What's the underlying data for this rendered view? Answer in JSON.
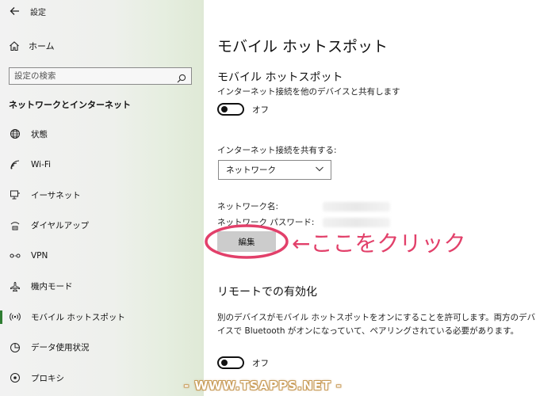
{
  "window": {
    "title": "設定"
  },
  "sidebar": {
    "home_label": "ホーム",
    "search_placeholder": "設定の検索",
    "section_label": "ネットワークとインターネット",
    "items": [
      {
        "label": "状態",
        "icon": "globe-icon"
      },
      {
        "label": "Wi-Fi",
        "icon": "wifi-icon"
      },
      {
        "label": "イーサネット",
        "icon": "ethernet-icon"
      },
      {
        "label": "ダイヤルアップ",
        "icon": "dialup-icon"
      },
      {
        "label": "VPN",
        "icon": "vpn-icon"
      },
      {
        "label": "機内モード",
        "icon": "airplane-icon"
      },
      {
        "label": "モバイル ホットスポット",
        "icon": "hotspot-icon",
        "active": true
      },
      {
        "label": "データ使用状況",
        "icon": "data-usage-icon"
      },
      {
        "label": "プロキシ",
        "icon": "proxy-icon"
      }
    ]
  },
  "main": {
    "page_title": "モバイル ホットスポット",
    "hotspot": {
      "title": "モバイル ホットスポット",
      "description": "インターネット接続を他のデバイスと共有します",
      "toggle_state": "オフ"
    },
    "share": {
      "label": "インターネット接続を共有する:",
      "selected": "ネットワーク"
    },
    "network_name_label": "ネットワーク名:",
    "network_password_label": "ネットワーク パスワード:",
    "edit_button": "編集",
    "remote": {
      "title": "リモートでの有効化",
      "description": "別のデバイスがモバイル ホットスポットをオンにすることを許可します。両方のデバイスで Bluetooth がオンになっていて、ペアリングされている必要があります。",
      "toggle_state": "オフ"
    }
  },
  "annotation": {
    "text": "←ここをクリック",
    "color": "#e2406a"
  },
  "watermark": "- WWW.TSAPPS.NET -",
  "colors": {
    "accent": "#2f7d32",
    "annotation": "#e2406a",
    "button_bg": "#cccccc"
  }
}
